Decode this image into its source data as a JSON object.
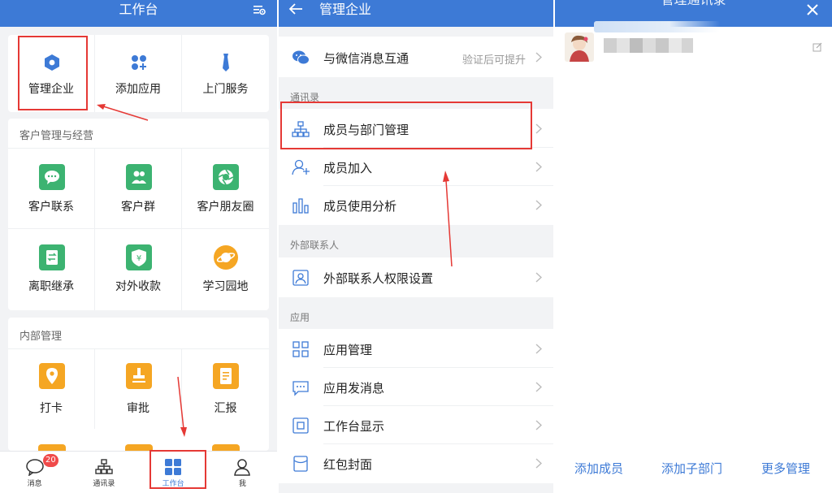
{
  "colors": {
    "header_blue": "#3d7ad6",
    "annotation_red": "#e53935",
    "icon_green": "#3cb371",
    "icon_orange": "#f5a623",
    "badge_red": "#f04a4a"
  },
  "workbench": {
    "title": "工作台",
    "top_row": [
      {
        "label": "管理企业",
        "icon": "hexagon-icon"
      },
      {
        "label": "添加应用",
        "icon": "apps-add-icon"
      },
      {
        "label": "上门服务",
        "icon": "tie-icon"
      }
    ],
    "customer_section": {
      "title": "客户管理与经营",
      "items": [
        {
          "label": "客户联系",
          "icon": "chat-bubble-icon"
        },
        {
          "label": "客户群",
          "icon": "group-icon"
        },
        {
          "label": "客户朋友圈",
          "icon": "aperture-icon"
        },
        {
          "label": "离职继承",
          "icon": "transfer-doc-icon"
        },
        {
          "label": "对外收款",
          "icon": "yuan-shield-icon"
        },
        {
          "label": "学习园地",
          "icon": "planet-icon"
        }
      ]
    },
    "internal_section": {
      "title": "内部管理",
      "items": [
        {
          "label": "打卡",
          "icon": "location-pin-icon"
        },
        {
          "label": "审批",
          "icon": "stamp-icon"
        },
        {
          "label": "汇报",
          "icon": "report-doc-icon"
        }
      ]
    },
    "bottom_nav": [
      {
        "label": "消息",
        "icon": "message-icon",
        "badge": "20"
      },
      {
        "label": "通讯录",
        "icon": "org-chart-icon"
      },
      {
        "label": "工作台",
        "icon": "grid-icon",
        "active": true
      },
      {
        "label": "我",
        "icon": "person-icon"
      }
    ]
  },
  "manage_enterprise": {
    "title": "管理企业",
    "wechat_item": {
      "label": "与微信消息互通",
      "hint": "验证后可提升"
    },
    "contacts_group": {
      "label": "通讯录",
      "items": [
        {
          "label": "成员与部门管理",
          "icon": "org-chart-icon"
        },
        {
          "label": "成员加入",
          "icon": "add-person-icon"
        },
        {
          "label": "成员使用分析",
          "icon": "bar-chart-icon"
        }
      ]
    },
    "external_group": {
      "label": "外部联系人",
      "items": [
        {
          "label": "外部联系人权限设置",
          "icon": "contact-card-icon"
        }
      ]
    },
    "apps_group": {
      "label": "应用",
      "items": [
        {
          "label": "应用管理",
          "icon": "four-squares-icon"
        },
        {
          "label": "应用发消息",
          "icon": "message-dots-icon"
        },
        {
          "label": "工作台显示",
          "icon": "window-icon"
        },
        {
          "label": "红包封面",
          "icon": "envelope-icon"
        }
      ]
    }
  },
  "manage_contacts": {
    "title": "管理通讯录",
    "actions": [
      "添加成员",
      "添加子部门",
      "更多管理"
    ]
  }
}
